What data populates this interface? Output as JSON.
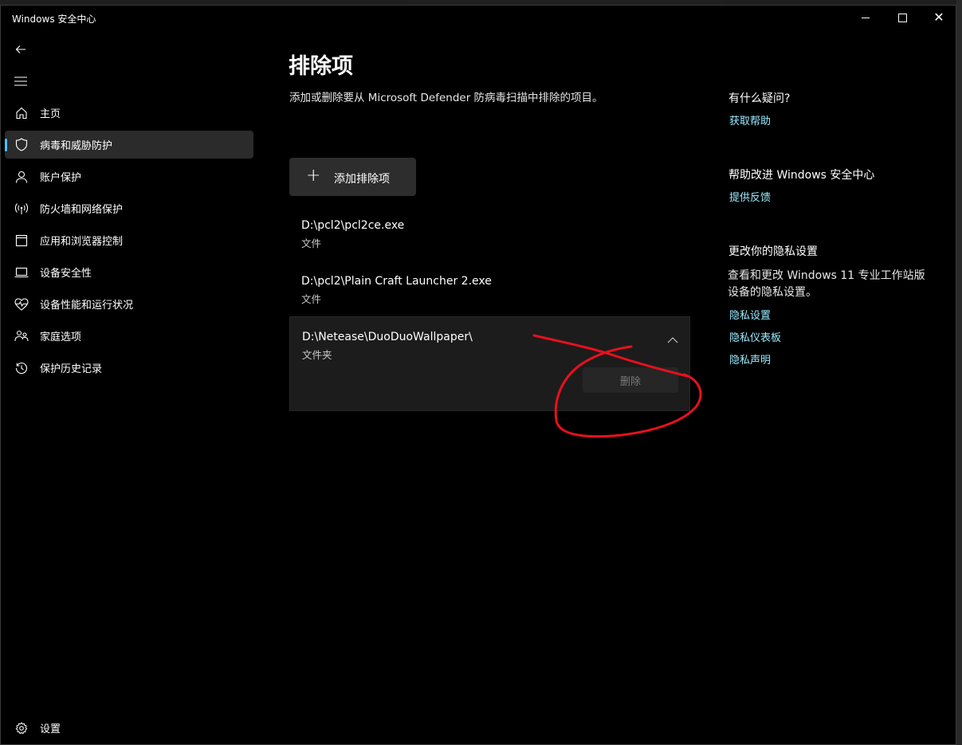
{
  "window": {
    "title": "Windows 安全中心"
  },
  "sidebar": {
    "items": [
      {
        "label": "主页",
        "icon": "home-icon",
        "active": false
      },
      {
        "label": "病毒和威胁防护",
        "icon": "shield-icon",
        "active": true
      },
      {
        "label": "账户保护",
        "icon": "person-icon",
        "active": false
      },
      {
        "label": "防火墙和网络保护",
        "icon": "network-antenna-icon",
        "active": false
      },
      {
        "label": "应用和浏览器控制",
        "icon": "app-browser-icon",
        "active": false
      },
      {
        "label": "设备安全性",
        "icon": "laptop-icon",
        "active": false
      },
      {
        "label": "设备性能和运行状况",
        "icon": "heart-pulse-icon",
        "active": false
      },
      {
        "label": "家庭选项",
        "icon": "family-icon",
        "active": false
      },
      {
        "label": "保护历史记录",
        "icon": "history-icon",
        "active": false
      }
    ],
    "settings_label": "设置"
  },
  "main": {
    "title": "排除项",
    "description": "添加或删除要从 Microsoft Defender 防病毒扫描中排除的项目。",
    "add_button_label": "添加排除项",
    "exclusions": [
      {
        "path": "D:\\pcl2\\pcl2ce.exe",
        "type": "文件",
        "expanded": false
      },
      {
        "path": "D:\\pcl2\\Plain Craft Launcher 2.exe",
        "type": "文件",
        "expanded": false
      },
      {
        "path": "D:\\Netease\\DuoDuoWallpaper\\",
        "type": "文件夹",
        "expanded": true
      }
    ],
    "remove_button_label": "删除"
  },
  "right_panel": {
    "help_heading": "有什么疑问?",
    "help_link": "获取帮助",
    "improve_heading": "帮助改进 Windows 安全中心",
    "feedback_link": "提供反馈",
    "privacy_heading": "更改你的隐私设置",
    "privacy_text": "查看和更改 Windows 11 专业工作站版 设备的隐私设置。",
    "privacy_links": [
      "隐私设置",
      "隐私仪表板",
      "隐私声明"
    ]
  },
  "colors": {
    "accent": "#4cc2ff",
    "link": "#99ebff",
    "annotation": "#e8101e"
  }
}
